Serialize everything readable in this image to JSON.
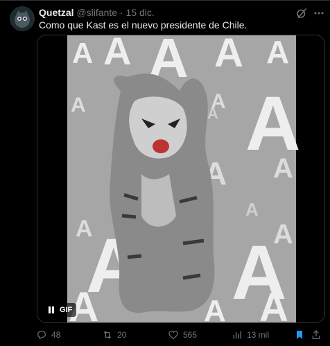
{
  "tweet": {
    "author_name": "Quetzal",
    "handle": "@slifante",
    "separator": "·",
    "time": "15 dic.",
    "text": "Como que Kast es el nuevo presidente de Chile."
  },
  "media": {
    "badge": "GIF",
    "background_letter": "A"
  },
  "actions": {
    "replies": "48",
    "reposts": "20",
    "likes": "565",
    "views": "13 mil"
  },
  "colors": {
    "background": "#000000",
    "text": "#e7e9ea",
    "muted": "#71767b",
    "accent": "#1d9bf0",
    "gif_bg": "#a6a6a6"
  }
}
